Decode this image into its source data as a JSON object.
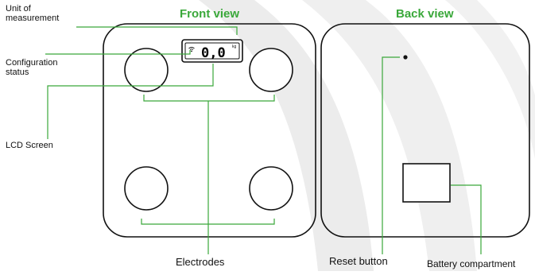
{
  "colors": {
    "accent_green": "#3aa83a",
    "outline": "#111111",
    "watermark": "#ebebeb"
  },
  "headings": {
    "front": "Front view",
    "back": "Back view"
  },
  "labels": {
    "unit_of_measurement_line1": "Unit of",
    "unit_of_measurement_line2": "measurement",
    "configuration_status_line1": "Configuration",
    "configuration_status_line2": "status",
    "lcd_screen": "LCD Screen",
    "electrodes": "Electrodes",
    "reset_button": "Reset button",
    "battery_compartment": "Battery compartment"
  },
  "lcd": {
    "reading": "0,0",
    "unit": "kg",
    "wifi_icon": "wifi-icon"
  }
}
